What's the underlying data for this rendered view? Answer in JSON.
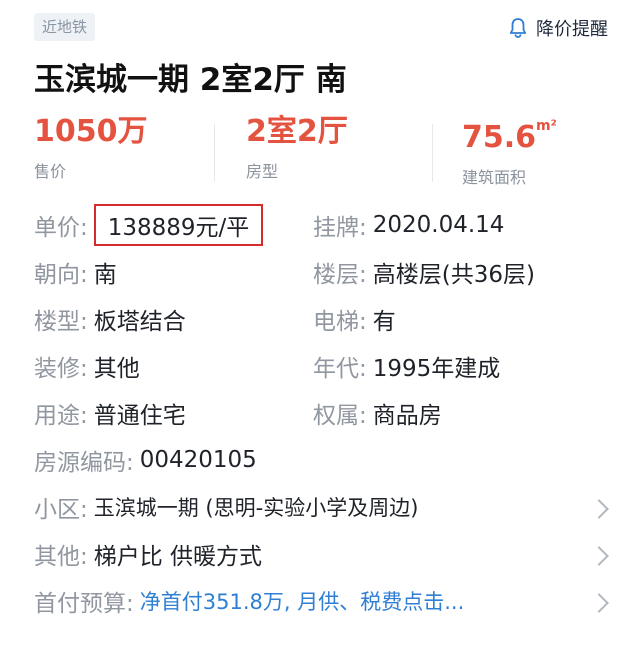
{
  "header": {
    "tag": "近地铁",
    "remind_label": "降价提醒"
  },
  "title": "玉滨城一期 2室2厅 南",
  "stats": {
    "price": {
      "value": "1050万",
      "label": "售价"
    },
    "layout": {
      "value": "2室2厅",
      "label": "房型"
    },
    "area": {
      "value": "75.6",
      "unit": "m²",
      "label": "建筑面积"
    }
  },
  "details": {
    "unit_price": {
      "key": "单价:",
      "value": "138889元/平"
    },
    "listed": {
      "key": "挂牌:",
      "value": "2020.04.14"
    },
    "orientation": {
      "key": "朝向:",
      "value": "南"
    },
    "floor": {
      "key": "楼层:",
      "value": "高楼层(共36层)"
    },
    "building_type": {
      "key": "楼型:",
      "value": "板塔结合"
    },
    "elevator": {
      "key": "电梯:",
      "value": "有"
    },
    "decoration": {
      "key": "装修:",
      "value": "其他"
    },
    "year": {
      "key": "年代:",
      "value": "1995年建成"
    },
    "usage": {
      "key": "用途:",
      "value": "普通住宅"
    },
    "ownership": {
      "key": "权属:",
      "value": "商品房"
    },
    "code": {
      "key": "房源编码:",
      "value": "00420105"
    },
    "community": {
      "key": "小区:",
      "value": "玉滨城一期 (思明-实验小学及周边)"
    },
    "other": {
      "key": "其他:",
      "value": "梯户比 供暖方式"
    },
    "budget": {
      "key": "首付预算:",
      "value": "净首付351.8万, 月供、税费点击..."
    }
  },
  "colors": {
    "accent": "#e4533f",
    "link": "#2f7fd4",
    "highlight_box": "#d62b2b"
  }
}
